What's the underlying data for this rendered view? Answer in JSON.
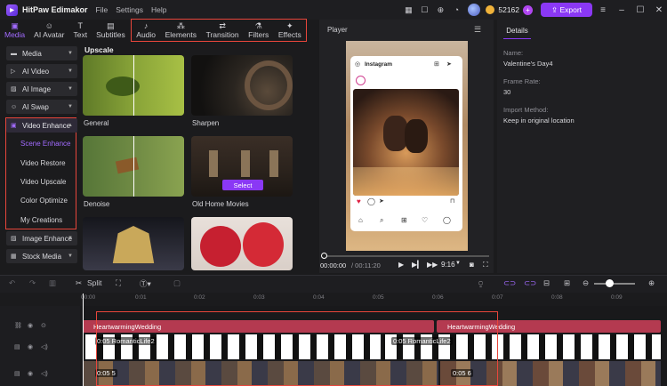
{
  "app": {
    "name": "HitPaw Edimakor",
    "menus": [
      "File",
      "Settings",
      "Help"
    ],
    "credits": "52162",
    "export_label": "Export"
  },
  "media_tabs": [
    {
      "label": "Media",
      "icon": "folder-icon"
    },
    {
      "label": "AI Avatar",
      "icon": "person-icon"
    },
    {
      "label": "Text",
      "icon": "text-icon"
    },
    {
      "label": "Subtitles",
      "icon": "subtitle-icon"
    }
  ],
  "tool_tabs": [
    {
      "label": "Audio",
      "icon": "music-icon"
    },
    {
      "label": "Elements",
      "icon": "elements-icon"
    },
    {
      "label": "Transition",
      "icon": "transition-icon"
    },
    {
      "label": "Filters",
      "icon": "filter-icon"
    },
    {
      "label": "Effects",
      "icon": "effects-icon"
    }
  ],
  "sidebar": {
    "categories_top": [
      "Media",
      "AI Video",
      "AI Image",
      "AI Swap"
    ],
    "enhance": {
      "label": "Video Enhance",
      "items": [
        "Scene Enhance",
        "Video Restore",
        "Video Upscale",
        "Color Optimize",
        "My Creations"
      ]
    },
    "categories_bottom": [
      "Image Enhance",
      "Stock Media"
    ]
  },
  "content": {
    "section_title": "Upscale",
    "thumbs": [
      {
        "label": "General"
      },
      {
        "label": "Sharpen"
      },
      {
        "label": "Denoise"
      },
      {
        "label": "Old Home Movies"
      },
      {
        "label": ""
      },
      {
        "label": ""
      }
    ],
    "select_label": "Select"
  },
  "player": {
    "title": "Player",
    "ig_brand": "Instagram",
    "time_current": "00:00:00",
    "time_total": "/ 00:11:20",
    "ratio": "9:16"
  },
  "details": {
    "tab": "Details",
    "name_label": "Name:",
    "name_value": "Valentine's Day4",
    "fps_label": "Frame Rate:",
    "fps_value": "30",
    "import_label": "Import Method:",
    "import_value": "Keep in original location"
  },
  "timeline": {
    "split_label": "Split",
    "ruler": [
      "00:00",
      "0:01",
      "0:02",
      "0:03",
      "0:04",
      "0:05",
      "0:06",
      "0:07",
      "0:08",
      "0:09"
    ],
    "clips": {
      "title1": "HeartwarmingWedding",
      "title2": "HeartwarmingWedding",
      "video1": "0:05  RomanticLife2",
      "video2": "0:05  RomanticLife2",
      "img1": "0:05  5",
      "img2": "0:05  6"
    }
  }
}
